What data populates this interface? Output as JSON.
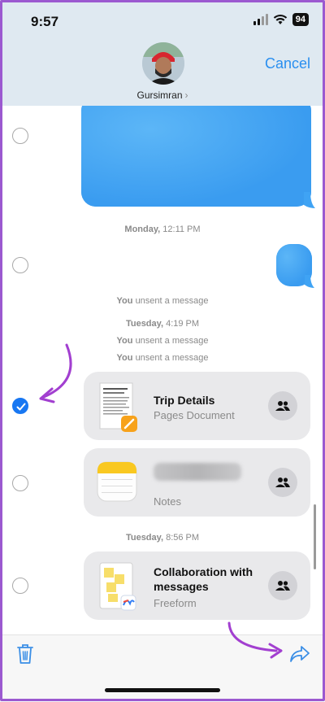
{
  "status": {
    "time": "9:57",
    "battery": "94"
  },
  "contact": {
    "name": "Gursimran",
    "chevron": "›"
  },
  "header": {
    "cancel_label": "Cancel"
  },
  "timestamps": {
    "t1_day": "Monday,",
    "t1_time": "12:11 PM",
    "t2_day": "Tuesday,",
    "t2_time": "4:19 PM",
    "t3_day": "Tuesday,",
    "t3_time": "8:56 PM"
  },
  "notices": {
    "n1_you": "You",
    "n1_rest": "unsent a message",
    "n2_you": "You",
    "n2_rest": "unsent a message",
    "n3_you": "You",
    "n3_rest": "unsent a message"
  },
  "cards": [
    {
      "title": "Trip Details",
      "subtitle": "Pages Document",
      "selected": true
    },
    {
      "title": "",
      "subtitle": "Notes",
      "selected": false
    },
    {
      "title": "Collaboration with messages",
      "subtitle": "Freeform",
      "selected": false
    }
  ],
  "colors": {
    "accent": "#2a8ff0",
    "bubble_blue": "#3fa3f4",
    "annotation_arrow": "#a23fd0"
  },
  "icons": {
    "trash": "trash-icon",
    "share": "share-arrow-icon",
    "people": "people-icon"
  }
}
